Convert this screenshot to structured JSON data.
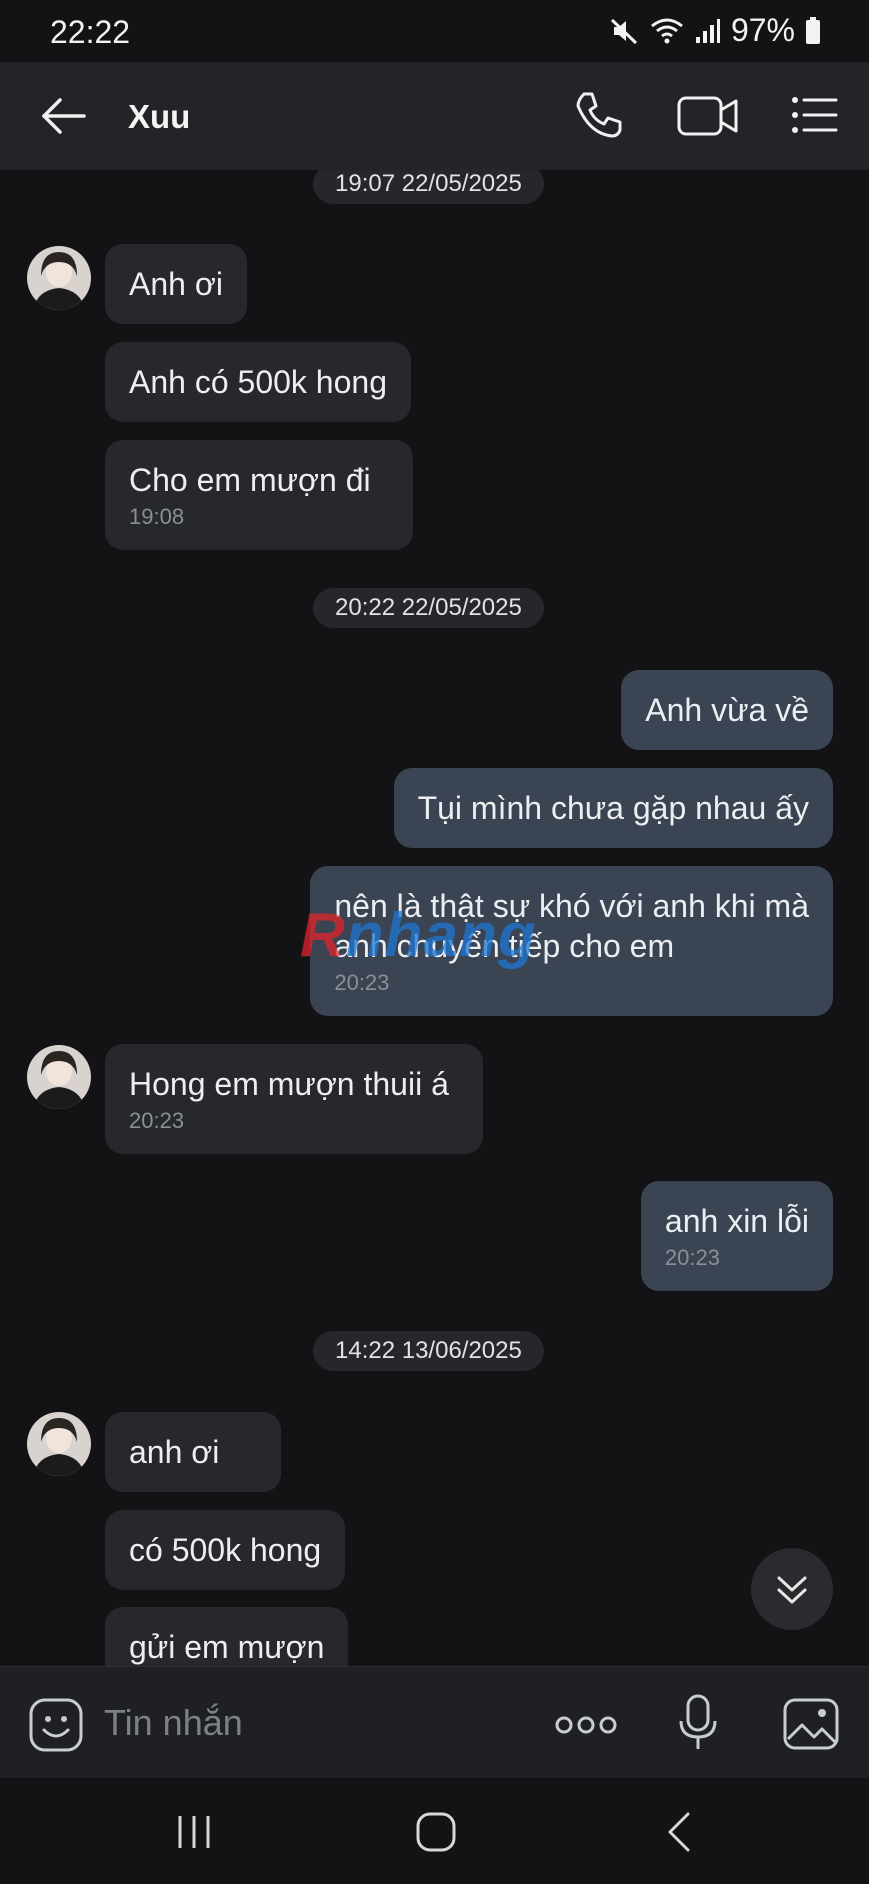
{
  "status_bar": {
    "time": "22:22",
    "battery": "97%"
  },
  "header": {
    "contact_name": "Xuu"
  },
  "messages": {
    "d1": "19:07 22/05/2025",
    "m1": "Anh ơi",
    "m2": "Anh có 500k hong",
    "m3": "Cho em mượn đi",
    "m3_time": "19:08",
    "d2": "20:22 22/05/2025",
    "m4": "Anh vừa về",
    "m5": "Tụi mình chưa gặp nhau ấy",
    "m6_line1": "nên là thật sự khó với anh khi mà",
    "m6_line2": "anh chuyển tiếp cho em",
    "m6_time": "20:23",
    "m7": "Hong em mượn thuii á",
    "m7_time": "20:23",
    "m8": "anh xin lỗi",
    "m8_time": "20:23",
    "d3": "14:22 13/06/2025",
    "m9": "anh ơi",
    "m10": "có 500k hong",
    "m11": "gửi em mượn"
  },
  "input": {
    "placeholder": "Tin nhắn"
  },
  "watermark": {
    "part1": "R",
    "part2": "nhang"
  },
  "colors": {
    "background": "#131315",
    "incoming_bubble": "#27282b",
    "outgoing_bubble": "#3a4452",
    "header": "#232427"
  },
  "icons": [
    "back-arrow-icon",
    "phone-icon",
    "video-camera-icon",
    "list-menu-icon",
    "emoji-icon",
    "more-dots-icon",
    "microphone-icon",
    "gallery-icon",
    "scroll-down-icon",
    "mute-icon",
    "wifi-icon",
    "signal-icon",
    "battery-icon"
  ]
}
